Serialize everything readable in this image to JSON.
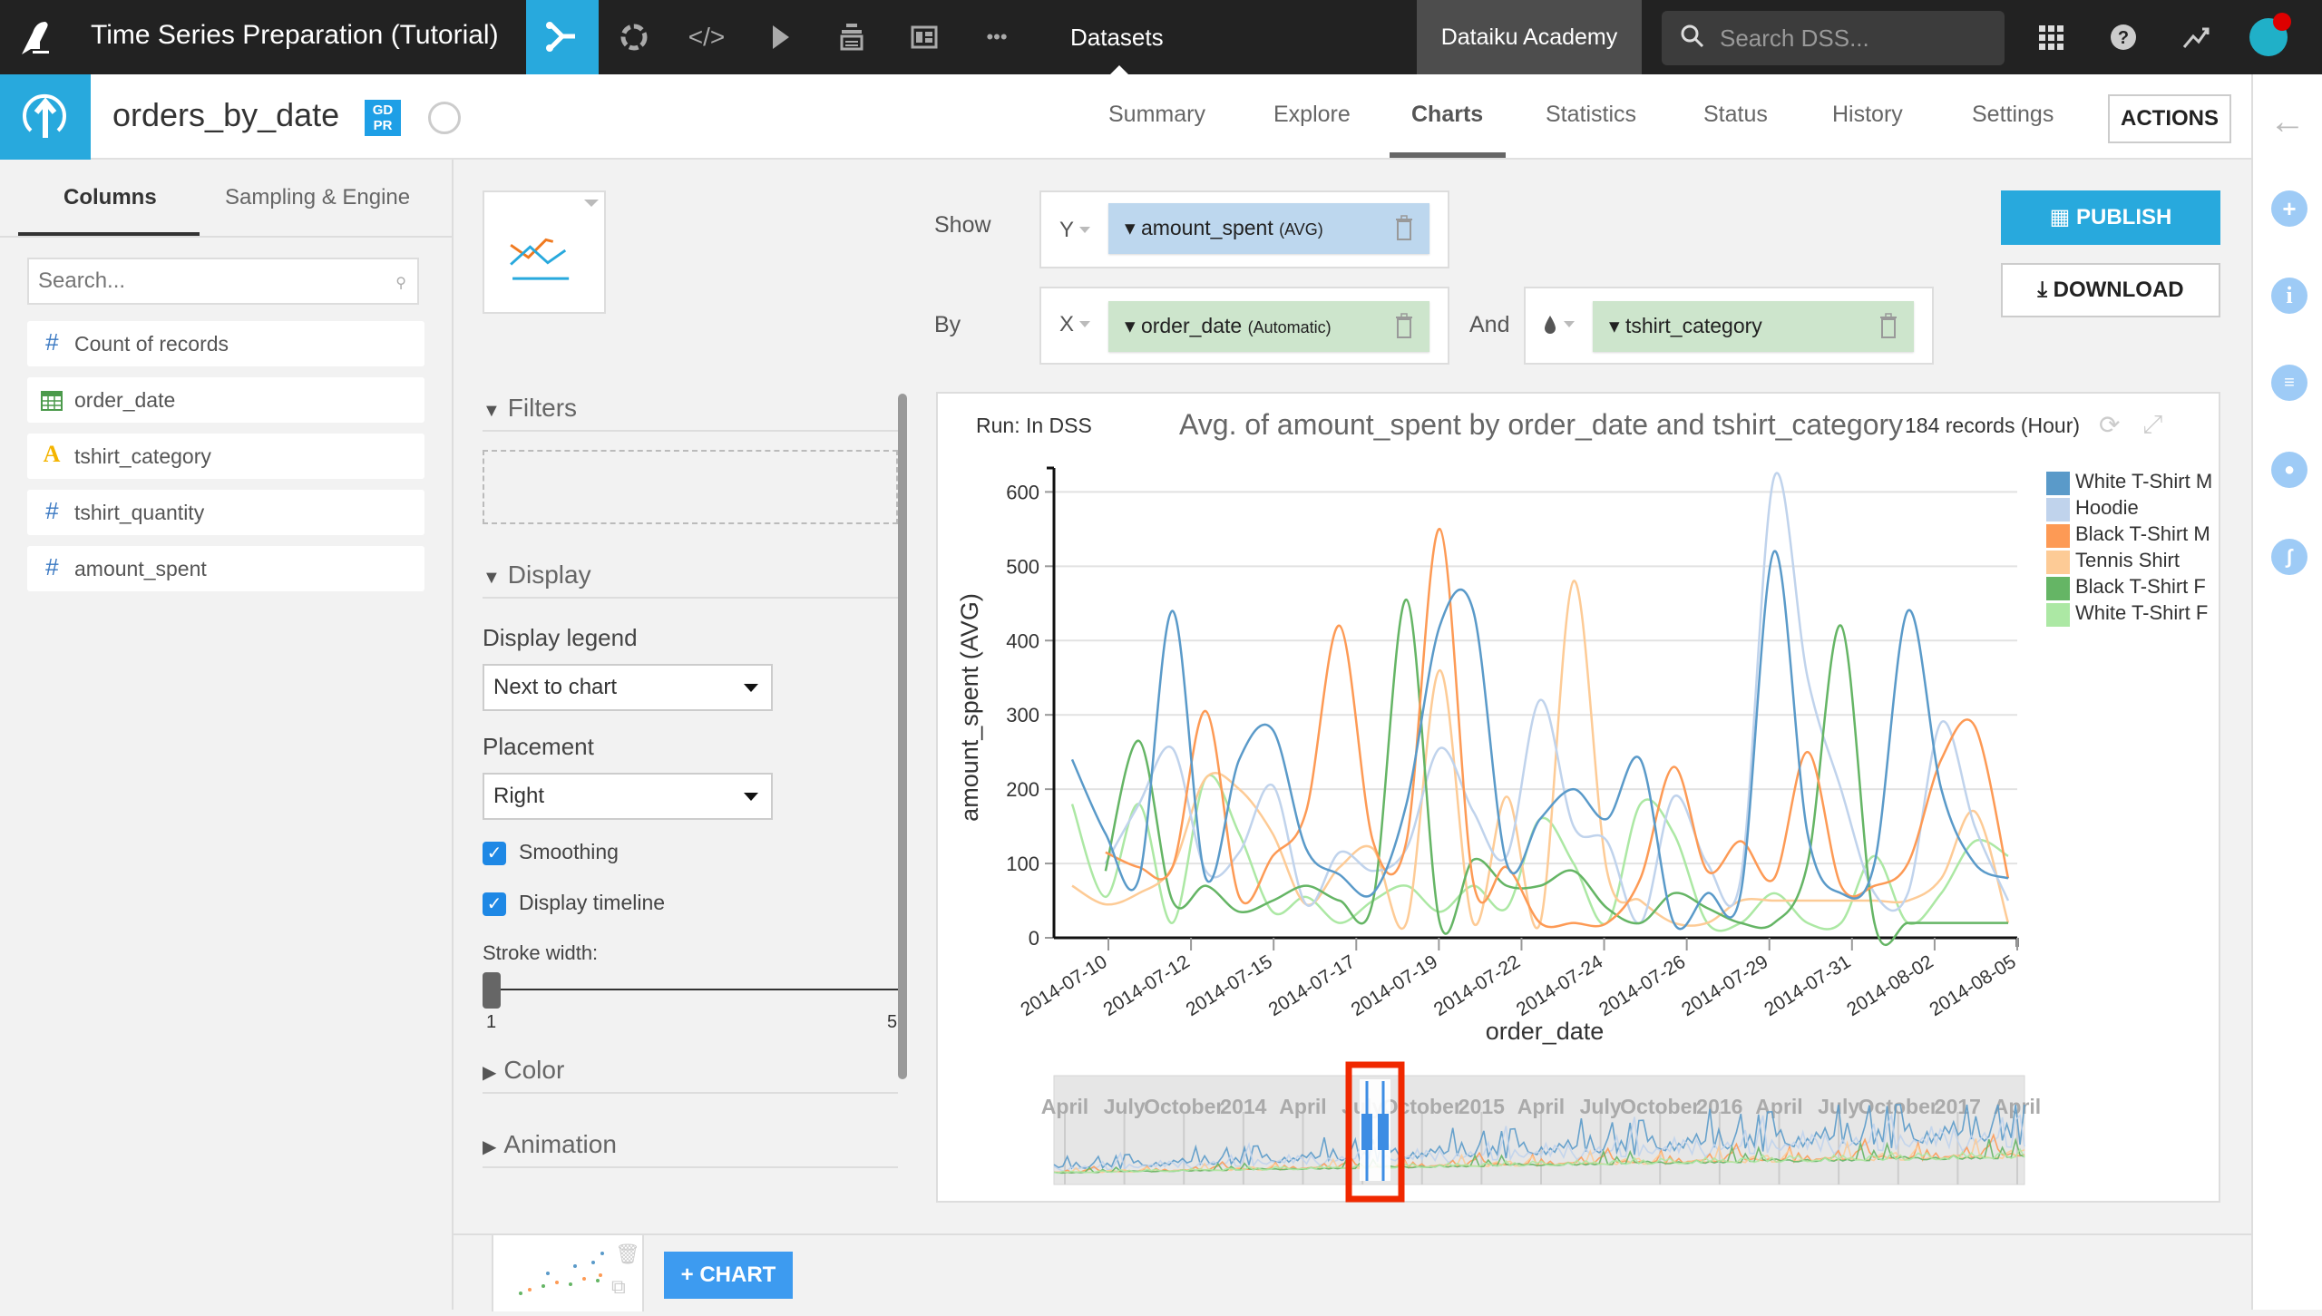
{
  "topbar": {
    "project_title": "Time Series Preparation (Tutorial)",
    "datasets_label": "Datasets",
    "academy_label": "Dataiku Academy",
    "search_placeholder": "Search DSS...",
    "nav_icons": [
      "flow-icon",
      "recipes-icon",
      "code-icon",
      "jobs-icon",
      "deploy-icon",
      "dashboards-icon",
      "more-icon"
    ]
  },
  "subheader": {
    "dataset_name": "orders_by_date",
    "gdpr_badge": [
      "GD",
      "PR"
    ],
    "tabs": [
      "Summary",
      "Explore",
      "Charts",
      "Statistics",
      "Status",
      "History",
      "Settings"
    ],
    "active_tab": "Charts",
    "actions_label": "ACTIONS"
  },
  "left_panel": {
    "tabs": [
      "Columns",
      "Sampling & Engine"
    ],
    "active_tab": "Columns",
    "search_placeholder": "Search...",
    "columns": [
      {
        "name": "Count of records",
        "type": "numeric",
        "icon": "#"
      },
      {
        "name": "order_date",
        "type": "date",
        "icon": "calendar"
      },
      {
        "name": "tshirt_category",
        "type": "text",
        "icon": "A"
      },
      {
        "name": "tshirt_quantity",
        "type": "numeric",
        "icon": "#"
      },
      {
        "name": "amount_spent",
        "type": "numeric",
        "icon": "#"
      }
    ]
  },
  "config": {
    "sections": {
      "filters": "Filters",
      "display": "Display",
      "color": "Color",
      "animation": "Animation"
    },
    "display_legend_label": "Display legend",
    "display_legend_value": "Next to chart",
    "placement_label": "Placement",
    "placement_value": "Right",
    "smoothing_label": "Smoothing",
    "smoothing_checked": true,
    "timeline_label": "Display timeline",
    "timeline_checked": true,
    "stroke_label": "Stroke width:",
    "stroke_min": "1",
    "stroke_max": "5",
    "stroke_value": 1
  },
  "shelves": {
    "show_label": "Show",
    "by_label": "By",
    "and_label": "And",
    "y_axis": "Y",
    "x_axis": "X",
    "y_measure": "amount_spent",
    "y_agg": "(AVG)",
    "x_dim": "order_date",
    "x_mode": "(Automatic)",
    "color_dim": "tshirt_category"
  },
  "buttons": {
    "publish": "PUBLISH",
    "download": "DOWNLOAD",
    "add_chart": "CHART"
  },
  "chart_header": {
    "run": "Run: In DSS",
    "records": "184 records (Hour)"
  },
  "chart_data": {
    "type": "line",
    "title": "Avg. of amount_spent by order_date and tshirt_category",
    "xlabel": "order_date",
    "ylabel": "amount_spent (AVG)",
    "ylim": [
      0,
      620
    ],
    "yticks": [
      0,
      100,
      200,
      300,
      400,
      500,
      600
    ],
    "xticks": [
      "2014-07-10",
      "2014-07-12",
      "2014-07-15",
      "2014-07-17",
      "2014-07-19",
      "2014-07-22",
      "2014-07-24",
      "2014-07-26",
      "2014-07-29",
      "2014-07-31",
      "2014-08-02",
      "2014-08-05"
    ],
    "grid": true,
    "smoothing": true,
    "legend_position": "right",
    "x": [
      "07-09",
      "07-10",
      "07-11",
      "07-12",
      "07-13",
      "07-14",
      "07-15",
      "07-16",
      "07-17",
      "07-18",
      "07-19",
      "07-20",
      "07-21",
      "07-22",
      "07-23",
      "07-24",
      "07-25",
      "07-26",
      "07-27",
      "07-28",
      "07-29",
      "07-30",
      "07-31",
      "08-01",
      "08-02",
      "08-03",
      "08-04",
      "08-05",
      "08-06"
    ],
    "series": [
      {
        "name": "White T-Shirt M",
        "color": "#5a9ac9",
        "values": [
          240,
          140,
          80,
          440,
          80,
          240,
          280,
          120,
          85,
          60,
          180,
          420,
          440,
          100,
          160,
          200,
          160,
          240,
          20,
          60,
          60,
          520,
          140,
          60,
          100,
          440,
          200,
          100,
          80
        ]
      },
      {
        "name": "Hoodie",
        "color": "#c0d3ec",
        "values": [
          null,
          100,
          180,
          255,
          90,
          115,
          205,
          45,
          115,
          90,
          120,
          255,
          170,
          110,
          320,
          150,
          130,
          20,
          190,
          100,
          80,
          620,
          350,
          200,
          60,
          60,
          290,
          150,
          50
        ]
      },
      {
        "name": "Black T-Shirt M",
        "color": "#fd9a55",
        "values": [
          null,
          115,
          95,
          95,
          305,
          55,
          110,
          170,
          420,
          130,
          130,
          550,
          75,
          95,
          20,
          20,
          20,
          80,
          230,
          90,
          130,
          80,
          250,
          70,
          70,
          100,
          240,
          285,
          80
        ]
      },
      {
        "name": "Tennis Shirt",
        "color": "#fdcb96",
        "values": [
          70,
          45,
          60,
          95,
          215,
          200,
          140,
          45,
          95,
          120,
          20,
          360,
          20,
          190,
          20,
          480,
          90,
          50,
          20,
          20,
          50,
          50,
          50,
          50,
          50,
          50,
          80,
          170,
          20
        ]
      },
      {
        "name": "Black T-Shirt F",
        "color": "#65b565",
        "values": [
          null,
          90,
          265,
          50,
          70,
          35,
          50,
          70,
          50,
          50,
          455,
          20,
          105,
          70,
          70,
          90,
          40,
          20,
          60,
          40,
          20,
          20,
          100,
          420,
          20,
          20,
          20,
          20,
          20
        ]
      },
      {
        "name": "White T-Shirt F",
        "color": "#ace8a4",
        "values": [
          180,
          55,
          180,
          20,
          215,
          140,
          35,
          55,
          20,
          50,
          70,
          35,
          70,
          40,
          160,
          100,
          20,
          180,
          140,
          20,
          20,
          60,
          20,
          20,
          110,
          20,
          60,
          130,
          110
        ]
      }
    ],
    "timeline": {
      "labels": [
        "April",
        "July",
        "October",
        "2014",
        "April",
        "July",
        "October",
        "2015",
        "April",
        "July",
        "October",
        "2016",
        "April",
        "July",
        "October",
        "2017",
        "April"
      ],
      "selection": "2014-07-09 to 2014-08-06"
    }
  }
}
